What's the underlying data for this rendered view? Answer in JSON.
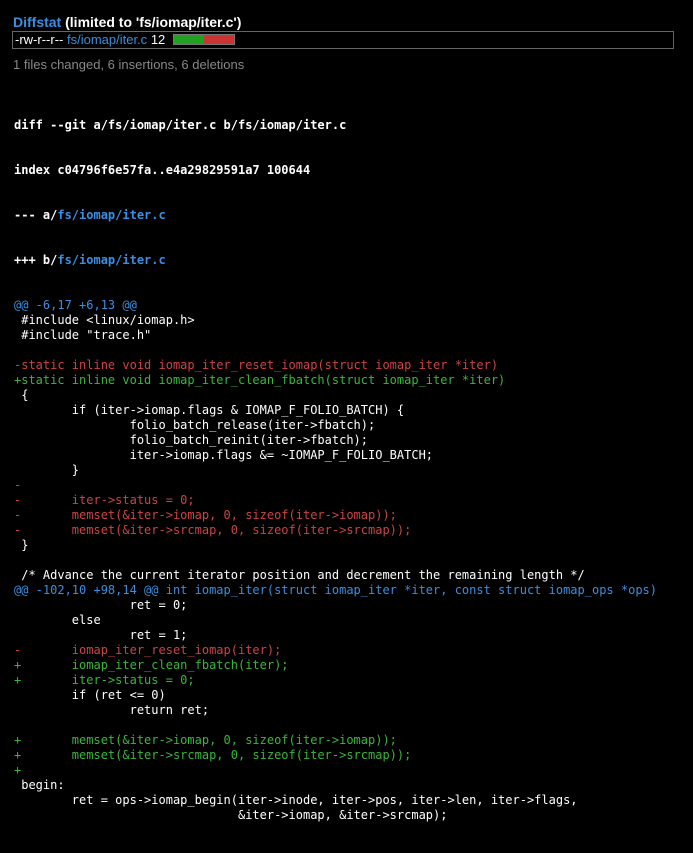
{
  "diffstat": {
    "title_link": "Diffstat",
    "title_rest": " (limited to 'fs/iomap/iter.c')",
    "mode": "-rw-r--r--",
    "file": "fs/iomap/iter.c",
    "count": "12",
    "insertions_bar_fraction": 0.5,
    "deletions_bar_fraction": 0.5
  },
  "summary": "1 files changed, 6 insertions, 6 deletions",
  "colors": {
    "link": "#3c8ee0",
    "added": "#3cb53c",
    "removed": "#c44",
    "background": "#000000"
  },
  "diff": {
    "header_lines": [
      "diff --git a/fs/iomap/iter.c b/fs/iomap/iter.c",
      "index c04796f6e57fa..e4a29829591a7 100644"
    ],
    "minus_file_prefix": "--- a/",
    "minus_file": "fs/iomap/iter.c",
    "plus_file_prefix": "+++ b/",
    "plus_file": "fs/iomap/iter.c",
    "lines": [
      {
        "type": "hunk",
        "text": "@@ -6,17 +6,13 @@"
      },
      {
        "type": "ctx",
        "text": " #include <linux/iomap.h>"
      },
      {
        "type": "ctx",
        "text": " #include \"trace.h\""
      },
      {
        "type": "ctx",
        "text": ""
      },
      {
        "type": "del",
        "text": "-static inline void iomap_iter_reset_iomap(struct iomap_iter *iter)"
      },
      {
        "type": "add",
        "text": "+static inline void iomap_iter_clean_fbatch(struct iomap_iter *iter)"
      },
      {
        "type": "ctx",
        "text": " {"
      },
      {
        "type": "ctx",
        "text": "        if (iter->iomap.flags & IOMAP_F_FOLIO_BATCH) {"
      },
      {
        "type": "ctx",
        "text": "                folio_batch_release(iter->fbatch);"
      },
      {
        "type": "ctx",
        "text": "                folio_batch_reinit(iter->fbatch);"
      },
      {
        "type": "ctx",
        "text": "                iter->iomap.flags &= ~IOMAP_F_FOLIO_BATCH;"
      },
      {
        "type": "ctx",
        "text": "        }"
      },
      {
        "type": "del",
        "text": "-"
      },
      {
        "type": "del",
        "text": "-       iter->status = 0;"
      },
      {
        "type": "del",
        "text": "-       memset(&iter->iomap, 0, sizeof(iter->iomap));"
      },
      {
        "type": "del",
        "text": "-       memset(&iter->srcmap, 0, sizeof(iter->srcmap));"
      },
      {
        "type": "ctx",
        "text": " }"
      },
      {
        "type": "ctx",
        "text": ""
      },
      {
        "type": "ctx",
        "text": " /* Advance the current iterator position and decrement the remaining length */"
      },
      {
        "type": "hunk",
        "text": "@@ -102,10 +98,14 @@ int iomap_iter(struct iomap_iter *iter, const struct iomap_ops *ops)"
      },
      {
        "type": "ctx",
        "text": "                ret = 0;"
      },
      {
        "type": "ctx",
        "text": "        else"
      },
      {
        "type": "ctx",
        "text": "                ret = 1;"
      },
      {
        "type": "del",
        "text": "-       iomap_iter_reset_iomap(iter);"
      },
      {
        "type": "add",
        "text": "+       iomap_iter_clean_fbatch(iter);"
      },
      {
        "type": "add",
        "text": "+       iter->status = 0;"
      },
      {
        "type": "ctx",
        "text": "        if (ret <= 0)"
      },
      {
        "type": "ctx",
        "text": "                return ret;"
      },
      {
        "type": "ctx",
        "text": ""
      },
      {
        "type": "add",
        "text": "+       memset(&iter->iomap, 0, sizeof(iter->iomap));"
      },
      {
        "type": "add",
        "text": "+       memset(&iter->srcmap, 0, sizeof(iter->srcmap));"
      },
      {
        "type": "add",
        "text": "+"
      },
      {
        "type": "ctx",
        "text": " begin:"
      },
      {
        "type": "ctx",
        "text": "        ret = ops->iomap_begin(iter->inode, iter->pos, iter->len, iter->flags,"
      },
      {
        "type": "ctx",
        "text": "                               &iter->iomap, &iter->srcmap);"
      }
    ]
  }
}
